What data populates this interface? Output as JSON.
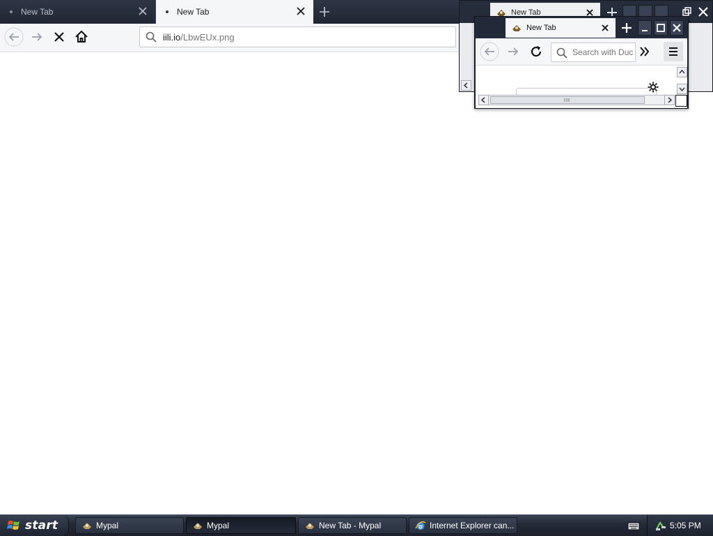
{
  "main_window": {
    "tabs": [
      {
        "label": "New Tab",
        "active": false
      },
      {
        "label": "New Tab",
        "active": true
      }
    ],
    "url": {
      "host": "iili.io",
      "path": "/LbwEUx.png"
    }
  },
  "background_window": {
    "tab_label": "New Tab"
  },
  "popup_window": {
    "tab_label": "New Tab",
    "search_placeholder": "Search with DuckDuckGo"
  },
  "taskbar": {
    "start_label": "start",
    "tasks": [
      {
        "label": "Mypal",
        "icon": "mypal-icon",
        "active": false
      },
      {
        "label": "Mypal",
        "icon": "mypal-icon",
        "active": true
      },
      {
        "label": "New Tab - Mypal",
        "icon": "mypal-icon",
        "active": false
      },
      {
        "label": "Internet Explorer can...",
        "icon": "ie-icon",
        "active": false
      }
    ],
    "clock": "5:05 PM"
  },
  "colors": {
    "tabbar": "#2e3646",
    "toolbar": "#f5f6f7",
    "taskbar": "#252b37"
  }
}
